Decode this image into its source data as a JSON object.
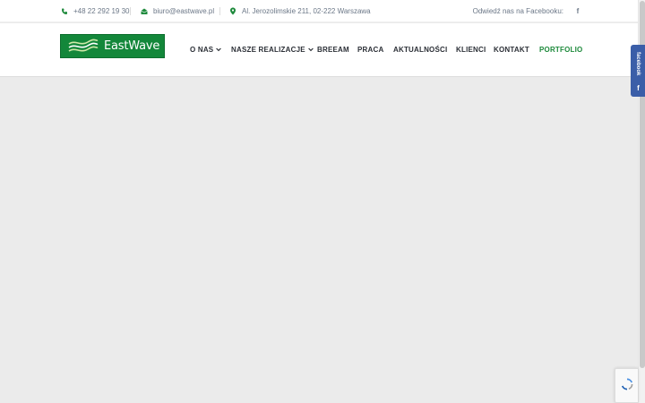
{
  "topbar": {
    "phone": "+48 22 292 19 30",
    "email": "biuro@eastwave.pl",
    "address": "Al. Jerozolimskie 211, 02-222 Warszawa",
    "facebook_text": "Odwiedź nas na Facebooku:",
    "facebook_icon": "f"
  },
  "header": {
    "logo_text": "EastWave",
    "nav": [
      {
        "label": "O NAS",
        "has_dropdown": true
      },
      {
        "label": "NASZE REALIZACJE",
        "has_dropdown": true
      },
      {
        "label": "BREEAM"
      },
      {
        "label": "PRACA"
      },
      {
        "label": "AKTUALNOŚCI"
      },
      {
        "label": "KLIENCI"
      },
      {
        "label": "KONTAKT"
      },
      {
        "label": "PORTFOLIO",
        "active": true
      }
    ]
  },
  "side_tab": {
    "label": "facebook",
    "icon": "f"
  },
  "colors": {
    "brand_green": "#13873a",
    "active_nav": "#1e8a3c",
    "content_bg": "#ebebeb",
    "facebook_blue": "#3b5ea8"
  }
}
